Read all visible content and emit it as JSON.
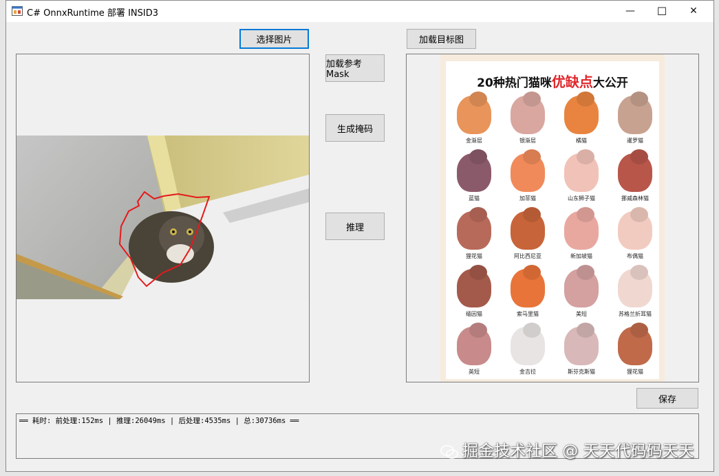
{
  "window": {
    "title": "C# OnnxRuntime 部署 INSID3",
    "minimize_glyph": "—",
    "maximize_glyph": "☐",
    "close_glyph": "✕"
  },
  "buttons": {
    "select_image": "选择图片",
    "load_target": "加载目标图",
    "load_ref_mask": "加载参考Mask",
    "generate_mask": "生成掩码",
    "infer": "推理",
    "save": "保存"
  },
  "poster": {
    "title_prefix": "20种热门猫咪",
    "title_highlight": "优缺点",
    "title_suffix": "大公开",
    "title_highlight_color": "#e0262b",
    "cats": [
      "金渐层",
      "银渐层",
      "橘猫",
      "暹罗猫",
      "蓝猫",
      "加菲猫",
      "山东狮子猫",
      "挪威森林猫",
      "狸花猫",
      "阿比西尼亚",
      "新加坡猫",
      "布偶猫",
      "缅因猫",
      "索马里猫",
      "美短",
      "苏格兰折耳猫",
      "英短",
      "金吉拉",
      "斯芬克斯猫",
      "狸花猫"
    ]
  },
  "log": {
    "text": "══ 耗时: 前处理:152ms | 推理:26049ms | 后处理:4535ms | 总:30736ms ══"
  },
  "watermark": {
    "text": "掘金技术社区 @ 天天代码码天天"
  },
  "icons": {
    "app": "windows-form-icon",
    "wechat": "wechat-icon"
  },
  "colors": {
    "mask_outline": "#e41a1c",
    "focus_border": "#0078d7"
  }
}
